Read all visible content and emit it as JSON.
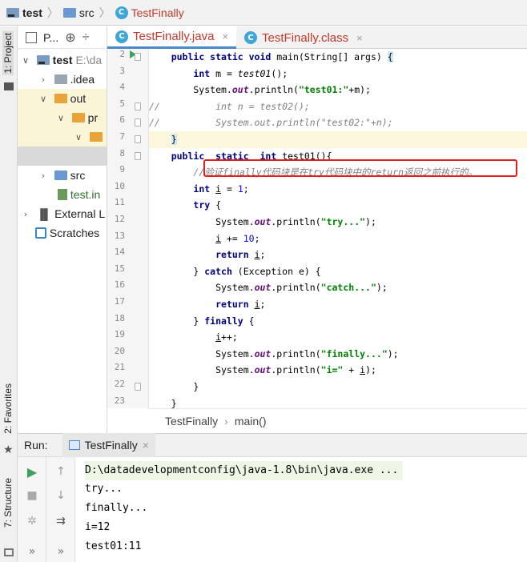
{
  "breadcrumb": {
    "project": "test",
    "folder": "src",
    "file": "TestFinally"
  },
  "project_panel": {
    "title": "P...",
    "tree": [
      {
        "label": "test",
        "suffix": "E:\\da"
      },
      {
        "label": ".idea"
      },
      {
        "label": "out"
      },
      {
        "label": "pr"
      },
      {
        "label": "src"
      },
      {
        "label": "test.in"
      },
      {
        "label": "External L"
      },
      {
        "label": "Scratches"
      }
    ]
  },
  "side_tabs": {
    "project": "1: Project",
    "favorites": "2: Favorites",
    "structure": "7: Structure"
  },
  "editor_tabs": [
    {
      "label": "TestFinally.java",
      "close": "×"
    },
    {
      "label": "TestFinally.class",
      "close": "×"
    }
  ],
  "line_numbers": [
    "2",
    "3",
    "4",
    "5",
    "6",
    "7",
    "8",
    "9",
    "10",
    "11",
    "12",
    "13",
    "14",
    "15",
    "16",
    "17",
    "18",
    "19",
    "20",
    "21",
    "22",
    "23"
  ],
  "editor_crumb": {
    "class_name": "TestFinally",
    "method": "main()"
  },
  "run_panel": {
    "label": "Run:",
    "tab": "TestFinally",
    "tab_close": "×",
    "output": [
      "D:\\datadevelopmentconfig\\java-1.8\\bin\\java.exe ...",
      "try...",
      "finally...",
      "i=12",
      "test01:11"
    ]
  }
}
